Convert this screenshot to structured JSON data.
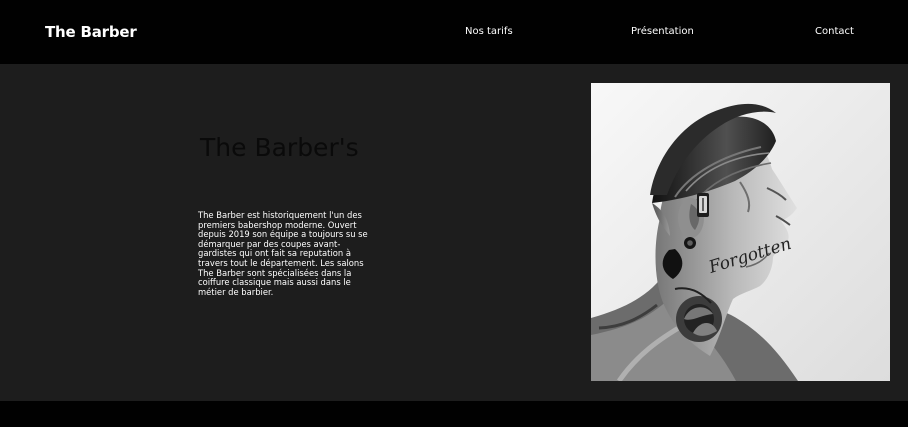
{
  "navbar": {
    "brand": "The Barber",
    "links": [
      "Nos tarifs",
      "Présentation",
      "Contact"
    ]
  },
  "hero": {
    "title": "The Barber's",
    "paragraph": "The Barber est historiquement l'un des premiers babershop moderne. Ouvert depuis 2019 son équipe a toujours su se démarquer par des coupes avant-gardistes qui ont fait sa reputation à travers tout le département. Les salons The Barber sont spécialisées dans la coiffure classique mais aussi dans le métier de barbier.",
    "photo_tattoo_text": "Forgotten"
  },
  "colors": {
    "nav_background": "#010101",
    "page_background": "#1d1d1d",
    "title_color": "#0a0a0a",
    "text_color": "#ffffff",
    "photo_background": "#f1f1f1"
  }
}
